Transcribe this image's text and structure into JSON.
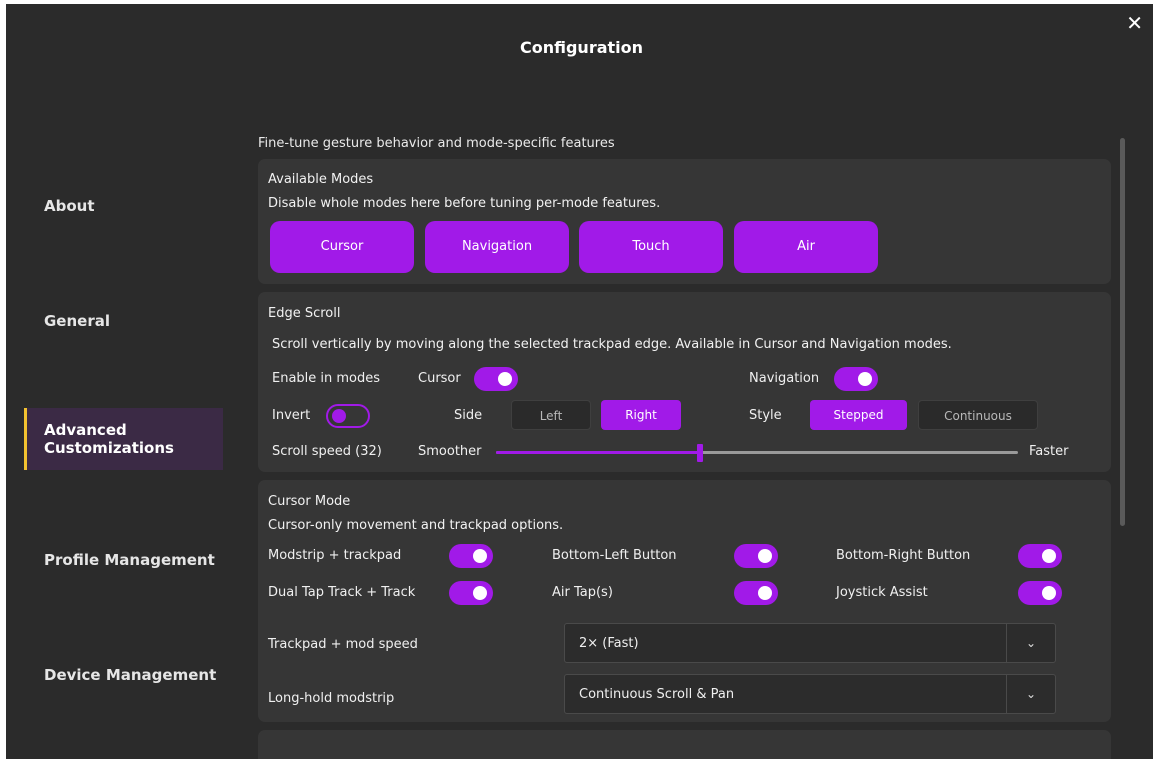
{
  "window": {
    "title": "Configuration",
    "close_glyph": "✕"
  },
  "sidebar": {
    "items": [
      {
        "label": "About",
        "active": false
      },
      {
        "label": "General",
        "active": false
      },
      {
        "label": "Advanced\nCustomizations",
        "active": true
      },
      {
        "label": "Profile Management",
        "active": false
      },
      {
        "label": "Device Management",
        "active": false
      }
    ]
  },
  "main": {
    "intro": "Fine-tune gesture behavior and mode-specific features",
    "available_modes": {
      "title": "Available Modes",
      "subtitle": "Disable whole modes here before tuning per-mode features.",
      "modes": [
        "Cursor",
        "Navigation",
        "Touch",
        "Air"
      ]
    },
    "edge_scroll": {
      "title": "Edge Scroll",
      "subtitle": "Scroll vertically by moving along the selected trackpad edge. Available in Cursor and Navigation modes.",
      "enable_label": "Enable in modes",
      "cursor_label": "Cursor",
      "cursor_on": true,
      "navigation_label": "Navigation",
      "navigation_on": true,
      "invert_label": "Invert",
      "invert_on": false,
      "side_label": "Side",
      "side_options": [
        "Left",
        "Right"
      ],
      "side_selected": "Right",
      "style_label": "Style",
      "style_options": [
        "Stepped",
        "Continuous"
      ],
      "style_selected": "Stepped",
      "speed_label": "Scroll speed (32)",
      "speed_min_label": "Smoother",
      "speed_max_label": "Faster",
      "speed_fraction": 0.39
    },
    "cursor_mode": {
      "title": "Cursor Mode",
      "subtitle": "Cursor-only movement and trackpad options.",
      "toggles": [
        {
          "label": "Modstrip + trackpad",
          "on": true
        },
        {
          "label": "Bottom-Left Button",
          "on": true
        },
        {
          "label": "Bottom-Right Button",
          "on": true
        },
        {
          "label": "Dual Tap Track + Track",
          "on": true
        },
        {
          "label": "Air Tap(s)",
          "on": true
        },
        {
          "label": "Joystick Assist",
          "on": true
        }
      ],
      "trackpad_speed_label": "Trackpad + mod speed",
      "trackpad_speed_value": "2× (Fast)",
      "long_hold_label": "Long-hold modstrip",
      "long_hold_value": "Continuous Scroll & Pan"
    }
  },
  "colors": {
    "accent": "#a11ae8",
    "background": "#2b2b2b",
    "card": "#363636",
    "active_indicator": "#f2c230"
  }
}
